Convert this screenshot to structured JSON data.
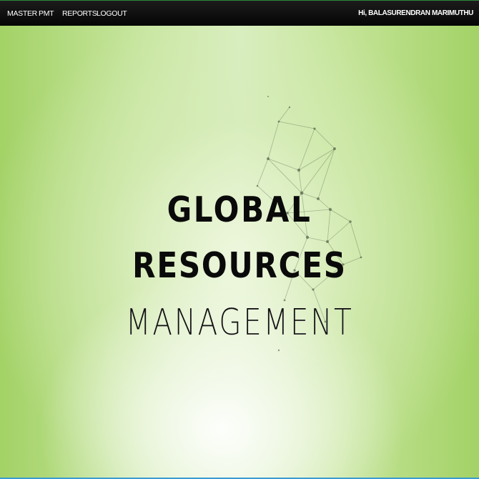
{
  "navbar": {
    "items": [
      {
        "label": "MASTER"
      },
      {
        "label": "PMT"
      },
      {
        "label": "REPORTS"
      },
      {
        "label": "LOGOUT"
      }
    ],
    "greeting": "Hi, BALASURENDRAN MARIMUTHU"
  },
  "hero": {
    "line1": "GLOBAL",
    "line2": "RESOURCES",
    "line3": "MANAGEMENT"
  },
  "colors": {
    "navbar_bg": "#0a0a0a",
    "background_green": "#a6d46a",
    "text_dark": "#0a0a0a"
  },
  "icons": {
    "network": "network-graph-decoration"
  }
}
